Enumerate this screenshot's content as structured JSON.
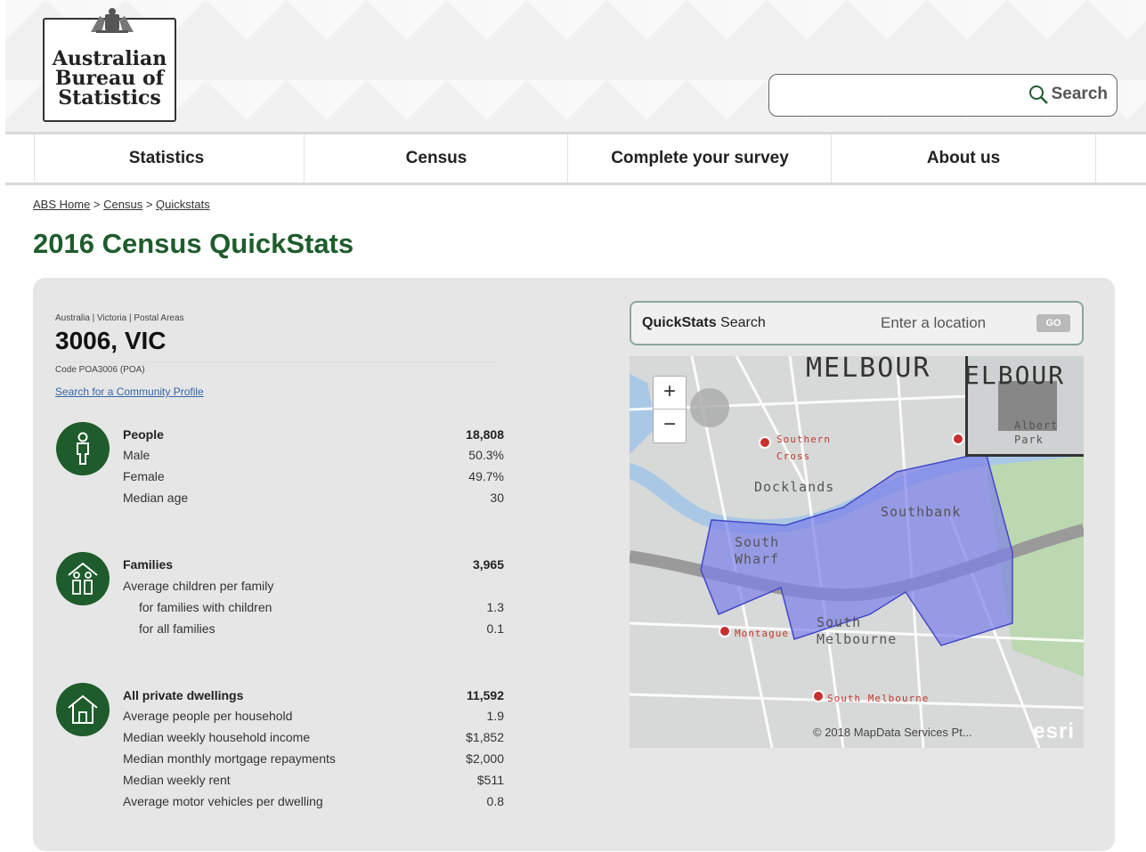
{
  "header": {
    "logo_text": "Australian\nBureau of\nStatistics",
    "search_button": "Search",
    "search_value": ""
  },
  "nav": {
    "items": [
      {
        "label": "Statistics"
      },
      {
        "label": "Census"
      },
      {
        "label": "Complete your survey"
      },
      {
        "label": "About us"
      }
    ]
  },
  "breadcrumb": {
    "home": "ABS Home",
    "sep1": " > ",
    "census": "Census",
    "sep2": " > ",
    "current": "Quickstats"
  },
  "page_title": "2016 Census QuickStats",
  "area": {
    "path": "Australia | Victoria | Postal Areas",
    "name": "3006, VIC",
    "code": "Code POA3006 (POA)",
    "community_link": "Search for a Community Profile"
  },
  "stats": {
    "people": [
      {
        "label": "People",
        "value": "18,808"
      },
      {
        "label": "Male",
        "value": "50.3%"
      },
      {
        "label": "Female",
        "value": "49.7%"
      },
      {
        "label": "Median age",
        "value": "30"
      }
    ],
    "families": [
      {
        "label": "Families",
        "value": "3,965"
      },
      {
        "label": "Average children per family",
        "value": ""
      },
      {
        "label": "for families with children",
        "value": "1.3"
      },
      {
        "label": "for all families",
        "value": "0.1"
      }
    ],
    "dwellings": [
      {
        "label": "All private dwellings",
        "value": "11,592"
      },
      {
        "label": "Average people per household",
        "value": "1.9"
      },
      {
        "label": "Median weekly household income",
        "value": "$1,852"
      },
      {
        "label": "Median monthly mortgage repayments",
        "value": "$2,000"
      },
      {
        "label": "Median weekly rent",
        "value": "$511"
      },
      {
        "label": "Average motor vehicles per dwelling",
        "value": "0.8"
      }
    ]
  },
  "quickstats_search": {
    "label_bold": "QuickStats",
    "label_rest": " Search",
    "placeholder": "Enter a location",
    "go_label": "GO"
  },
  "map": {
    "zoom_in": "+",
    "zoom_out": "−",
    "labels": {
      "melbourne": "MELBOUR",
      "docklands": "Docklands",
      "southbank": "Southbank",
      "south_wharf": "South\nWharf",
      "south_melbourne": "South\nMelbourne",
      "southern_cross": "Southern\nCross",
      "mortague": "Montague",
      "south_melbourne_station": "South Melbourne",
      "albert_park": "Albert\nPark",
      "overview_melbourne": "ELBOUR"
    },
    "attribution": "© 2018 MapData Services Pt...",
    "esri": "esri",
    "colors": {
      "highlight": "#7b7fe8",
      "water": "#a9c8e6",
      "park": "#bcd8b0"
    }
  }
}
